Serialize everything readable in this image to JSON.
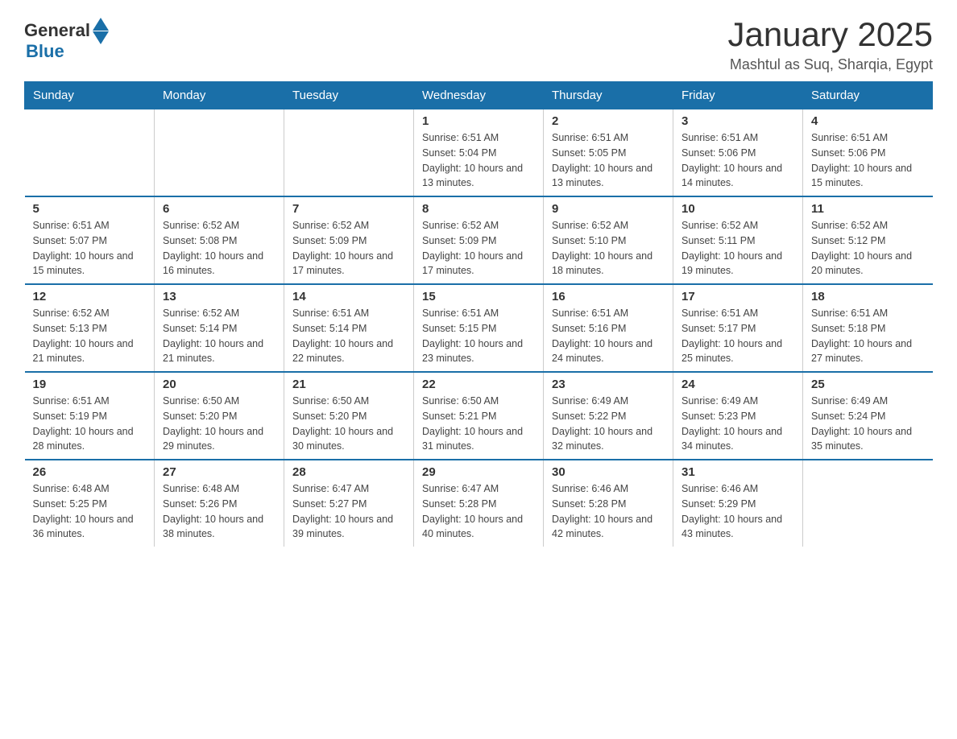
{
  "logo": {
    "text_general": "General",
    "text_blue": "Blue"
  },
  "header": {
    "title": "January 2025",
    "subtitle": "Mashtul as Suq, Sharqia, Egypt"
  },
  "weekdays": [
    "Sunday",
    "Monday",
    "Tuesday",
    "Wednesday",
    "Thursday",
    "Friday",
    "Saturday"
  ],
  "rows": [
    [
      {
        "day": "",
        "info": ""
      },
      {
        "day": "",
        "info": ""
      },
      {
        "day": "",
        "info": ""
      },
      {
        "day": "1",
        "info": "Sunrise: 6:51 AM\nSunset: 5:04 PM\nDaylight: 10 hours and 13 minutes."
      },
      {
        "day": "2",
        "info": "Sunrise: 6:51 AM\nSunset: 5:05 PM\nDaylight: 10 hours and 13 minutes."
      },
      {
        "day": "3",
        "info": "Sunrise: 6:51 AM\nSunset: 5:06 PM\nDaylight: 10 hours and 14 minutes."
      },
      {
        "day": "4",
        "info": "Sunrise: 6:51 AM\nSunset: 5:06 PM\nDaylight: 10 hours and 15 minutes."
      }
    ],
    [
      {
        "day": "5",
        "info": "Sunrise: 6:51 AM\nSunset: 5:07 PM\nDaylight: 10 hours and 15 minutes."
      },
      {
        "day": "6",
        "info": "Sunrise: 6:52 AM\nSunset: 5:08 PM\nDaylight: 10 hours and 16 minutes."
      },
      {
        "day": "7",
        "info": "Sunrise: 6:52 AM\nSunset: 5:09 PM\nDaylight: 10 hours and 17 minutes."
      },
      {
        "day": "8",
        "info": "Sunrise: 6:52 AM\nSunset: 5:09 PM\nDaylight: 10 hours and 17 minutes."
      },
      {
        "day": "9",
        "info": "Sunrise: 6:52 AM\nSunset: 5:10 PM\nDaylight: 10 hours and 18 minutes."
      },
      {
        "day": "10",
        "info": "Sunrise: 6:52 AM\nSunset: 5:11 PM\nDaylight: 10 hours and 19 minutes."
      },
      {
        "day": "11",
        "info": "Sunrise: 6:52 AM\nSunset: 5:12 PM\nDaylight: 10 hours and 20 minutes."
      }
    ],
    [
      {
        "day": "12",
        "info": "Sunrise: 6:52 AM\nSunset: 5:13 PM\nDaylight: 10 hours and 21 minutes."
      },
      {
        "day": "13",
        "info": "Sunrise: 6:52 AM\nSunset: 5:14 PM\nDaylight: 10 hours and 21 minutes."
      },
      {
        "day": "14",
        "info": "Sunrise: 6:51 AM\nSunset: 5:14 PM\nDaylight: 10 hours and 22 minutes."
      },
      {
        "day": "15",
        "info": "Sunrise: 6:51 AM\nSunset: 5:15 PM\nDaylight: 10 hours and 23 minutes."
      },
      {
        "day": "16",
        "info": "Sunrise: 6:51 AM\nSunset: 5:16 PM\nDaylight: 10 hours and 24 minutes."
      },
      {
        "day": "17",
        "info": "Sunrise: 6:51 AM\nSunset: 5:17 PM\nDaylight: 10 hours and 25 minutes."
      },
      {
        "day": "18",
        "info": "Sunrise: 6:51 AM\nSunset: 5:18 PM\nDaylight: 10 hours and 27 minutes."
      }
    ],
    [
      {
        "day": "19",
        "info": "Sunrise: 6:51 AM\nSunset: 5:19 PM\nDaylight: 10 hours and 28 minutes."
      },
      {
        "day": "20",
        "info": "Sunrise: 6:50 AM\nSunset: 5:20 PM\nDaylight: 10 hours and 29 minutes."
      },
      {
        "day": "21",
        "info": "Sunrise: 6:50 AM\nSunset: 5:20 PM\nDaylight: 10 hours and 30 minutes."
      },
      {
        "day": "22",
        "info": "Sunrise: 6:50 AM\nSunset: 5:21 PM\nDaylight: 10 hours and 31 minutes."
      },
      {
        "day": "23",
        "info": "Sunrise: 6:49 AM\nSunset: 5:22 PM\nDaylight: 10 hours and 32 minutes."
      },
      {
        "day": "24",
        "info": "Sunrise: 6:49 AM\nSunset: 5:23 PM\nDaylight: 10 hours and 34 minutes."
      },
      {
        "day": "25",
        "info": "Sunrise: 6:49 AM\nSunset: 5:24 PM\nDaylight: 10 hours and 35 minutes."
      }
    ],
    [
      {
        "day": "26",
        "info": "Sunrise: 6:48 AM\nSunset: 5:25 PM\nDaylight: 10 hours and 36 minutes."
      },
      {
        "day": "27",
        "info": "Sunrise: 6:48 AM\nSunset: 5:26 PM\nDaylight: 10 hours and 38 minutes."
      },
      {
        "day": "28",
        "info": "Sunrise: 6:47 AM\nSunset: 5:27 PM\nDaylight: 10 hours and 39 minutes."
      },
      {
        "day": "29",
        "info": "Sunrise: 6:47 AM\nSunset: 5:28 PM\nDaylight: 10 hours and 40 minutes."
      },
      {
        "day": "30",
        "info": "Sunrise: 6:46 AM\nSunset: 5:28 PM\nDaylight: 10 hours and 42 minutes."
      },
      {
        "day": "31",
        "info": "Sunrise: 6:46 AM\nSunset: 5:29 PM\nDaylight: 10 hours and 43 minutes."
      },
      {
        "day": "",
        "info": ""
      }
    ]
  ]
}
